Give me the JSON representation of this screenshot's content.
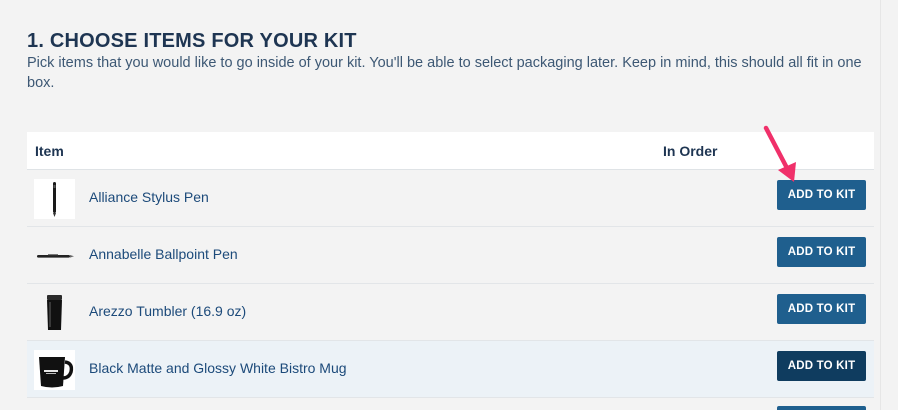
{
  "section": {
    "title": "1. CHOOSE ITEMS FOR YOUR KIT",
    "description": "Pick items that you would like to go inside of your kit. You'll be able to select packaging later. Keep in mind, this should all fit in one box."
  },
  "table": {
    "columns": [
      "Item",
      "In Order"
    ],
    "rows": [
      {
        "name": "Alliance Stylus Pen",
        "button": "ADD TO KIT",
        "icon": "stylus-pen-icon"
      },
      {
        "name": "Annabelle Ballpoint Pen",
        "button": "ADD TO KIT",
        "icon": "ballpoint-pen-icon"
      },
      {
        "name": "Arezzo Tumbler (16.9 oz)",
        "button": "ADD TO KIT",
        "icon": "tumbler-icon"
      },
      {
        "name": "Black Matte and Glossy White Bistro Mug",
        "button": "ADD TO KIT",
        "icon": "mug-icon"
      }
    ]
  },
  "colors": {
    "button": "#1f5f8e",
    "button_hover": "#0f3c5f",
    "annotation_arrow": "#f0306a",
    "title": "#1e3552"
  }
}
